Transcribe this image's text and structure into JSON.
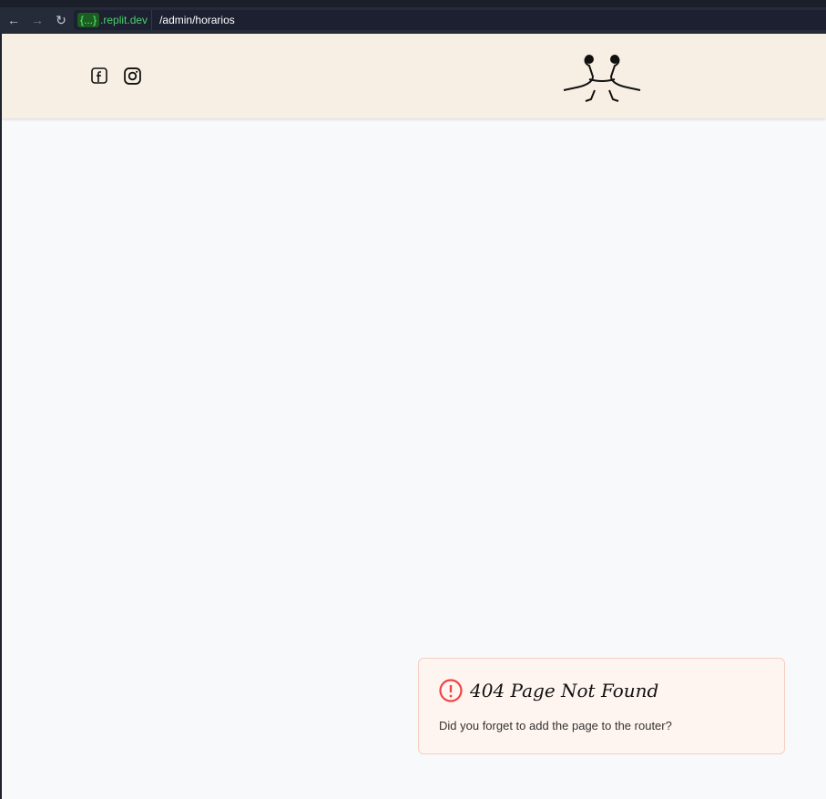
{
  "browser": {
    "domain_badge": "{...}",
    "domain": ".replit.dev",
    "path": "/admin/horarios"
  },
  "header": {
    "social": [
      "facebook-icon",
      "instagram-icon"
    ]
  },
  "error": {
    "title": "404 Page Not Found",
    "message": "Did you forget to add the page to the router?",
    "accent": "#ef4444"
  }
}
